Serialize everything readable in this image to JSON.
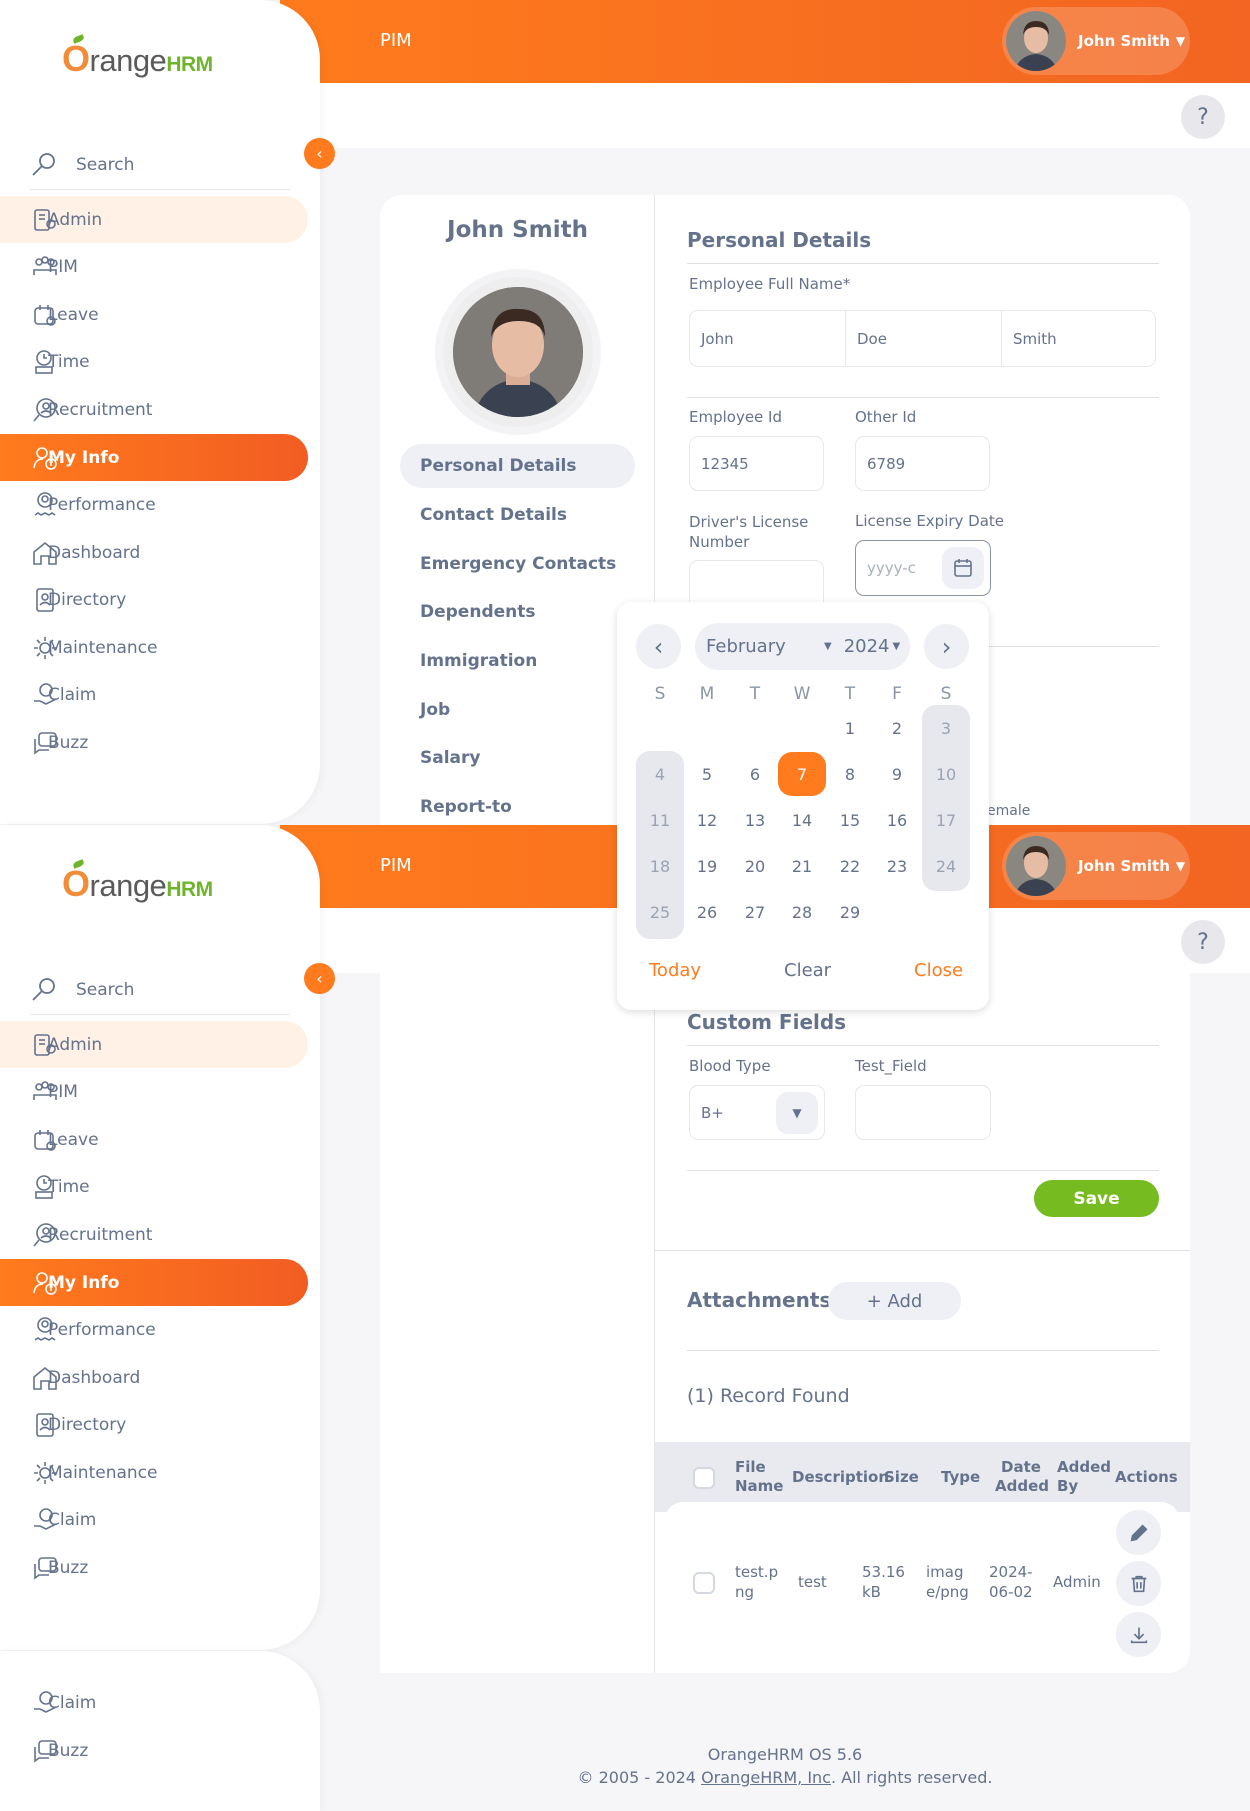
{
  "app": {
    "module_title": "PIM",
    "user_name": "John Smith",
    "help": "?"
  },
  "logo": {
    "text_o": "O",
    "text_range": "range",
    "text_hrm": "HRM"
  },
  "sidebar": {
    "search_label": "Search",
    "items": [
      {
        "label": "Admin",
        "icon": "admin-icon"
      },
      {
        "label": "PIM",
        "icon": "pim-icon"
      },
      {
        "label": "Leave",
        "icon": "leave-icon"
      },
      {
        "label": "Time",
        "icon": "time-icon"
      },
      {
        "label": "Recruitment",
        "icon": "recruitment-icon"
      },
      {
        "label": "My Info",
        "icon": "my-info-icon"
      },
      {
        "label": "Performance",
        "icon": "performance-icon"
      },
      {
        "label": "Dashboard",
        "icon": "dashboard-icon"
      },
      {
        "label": "Directory",
        "icon": "directory-icon"
      },
      {
        "label": "Maintenance",
        "icon": "maintenance-icon"
      },
      {
        "label": "Claim",
        "icon": "claim-icon"
      },
      {
        "label": "Buzz",
        "icon": "buzz-icon"
      }
    ]
  },
  "profile": {
    "name": "John Smith",
    "tabs": [
      "Personal Details",
      "Contact Details",
      "Emergency Contacts",
      "Dependents",
      "Immigration",
      "Job",
      "Salary",
      "Report-to"
    ]
  },
  "personal": {
    "section_title": "Personal Details",
    "full_name_label": "Employee Full Name*",
    "first_name": "John",
    "middle_name": "Doe",
    "last_name": "Smith",
    "employee_id_label": "Employee Id",
    "employee_id": "12345",
    "other_id_label": "Other Id",
    "other_id": "6789",
    "license_label": "Driver's License Number",
    "license_expiry_label": "License Expiry Date",
    "license_expiry_placeholder": "yyyy-c",
    "partial_text": "emale"
  },
  "calendar": {
    "month": "February",
    "year": "2024",
    "weekdays": [
      "S",
      "M",
      "T",
      "W",
      "T",
      "F",
      "S"
    ],
    "selected_day": "7",
    "weeks": [
      [
        "",
        "",
        "",
        "",
        "1",
        "2",
        "3"
      ],
      [
        "4",
        "5",
        "6",
        "7",
        "8",
        "9",
        "10"
      ],
      [
        "11",
        "12",
        "13",
        "14",
        "15",
        "16",
        "17"
      ],
      [
        "18",
        "19",
        "20",
        "21",
        "22",
        "23",
        "24"
      ],
      [
        "25",
        "26",
        "27",
        "28",
        "29",
        "",
        ""
      ]
    ],
    "today_label": "Today",
    "clear_label": "Clear",
    "close_label": "Close"
  },
  "custom": {
    "section_title": "Custom Fields",
    "blood_type_label": "Blood Type",
    "blood_type_value": "B+",
    "test_field_label": "Test_Field",
    "save_label": "Save"
  },
  "attachments": {
    "title": "Attachments",
    "add_label": "+ Add",
    "record_count": "(1) Record Found",
    "columns": [
      "File Name",
      "Description",
      "Size",
      "Type",
      "Date Added",
      "Added By",
      "Actions"
    ],
    "rows": [
      {
        "file": "test.png",
        "description": "test",
        "size": "53.16 kB",
        "type": "image/png",
        "date": "2024-06-02",
        "added_by": "Admin"
      }
    ]
  },
  "footer": {
    "version": "OrangeHRM OS 5.6",
    "copyright": "© 2005 - 2024 ",
    "company": "OrangeHRM, Inc",
    "rights": ". All rights reserved."
  },
  "colors": {
    "brand_orange": "#ff7b1d",
    "save_green": "#76bc21",
    "text": "#64728c"
  }
}
